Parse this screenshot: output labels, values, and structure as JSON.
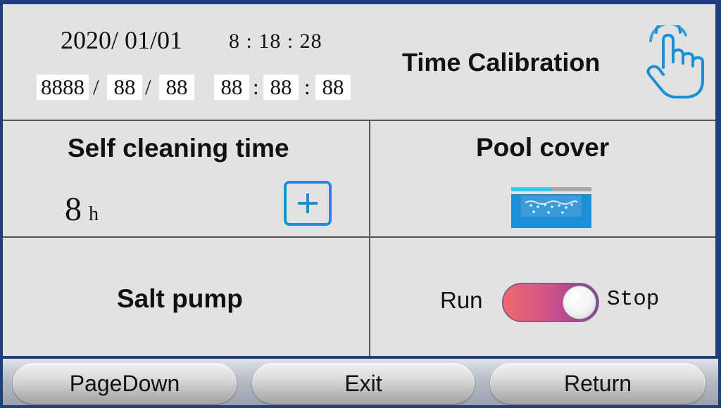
{
  "header": {
    "date": "2020/ 01/01",
    "time": "8 : 18 : 28",
    "edit": {
      "year": "8888",
      "month": "88",
      "day": "88",
      "hour": "88",
      "minute": "88",
      "second": "88",
      "date_sep": "/",
      "time_sep": ":"
    },
    "title": "Time Calibration",
    "icon": "hand-pointer-icon"
  },
  "self_cleaning": {
    "title": "Self cleaning time",
    "value": "8",
    "unit": "h",
    "plus_label": "+"
  },
  "pool_cover": {
    "title": "Pool cover",
    "icon": "pool-icon"
  },
  "salt_pump": {
    "title": "Salt pump",
    "run_label": "Run",
    "stop_label": "Stop",
    "state": "Stop"
  },
  "footer": {
    "page_down": "PageDown",
    "exit": "Exit",
    "return": "Return"
  },
  "colors": {
    "frame": "#1d3f7e",
    "panel": "#e2e2e2",
    "accent": "#1d8fd6",
    "pool_cyan": "#29d3f0"
  }
}
